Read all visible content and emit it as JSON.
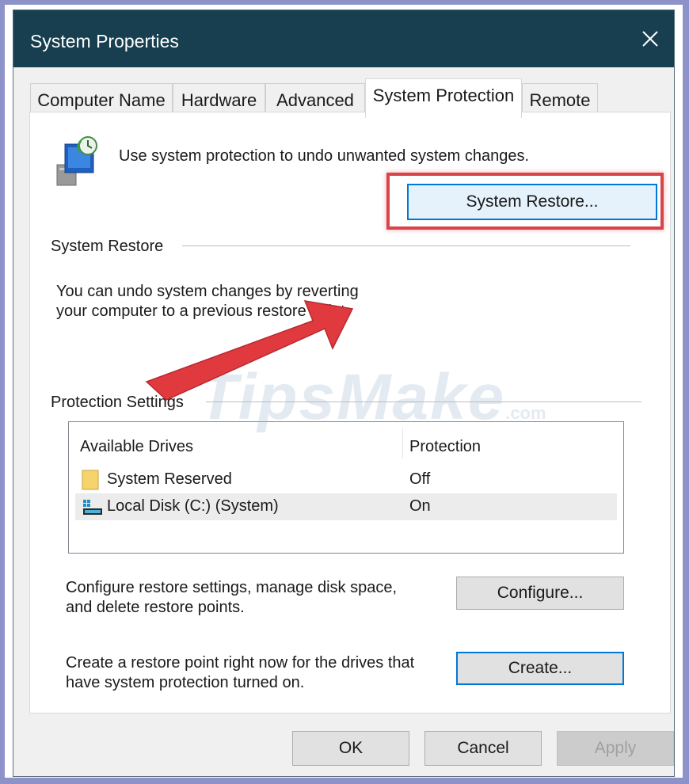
{
  "window": {
    "title": "System Properties"
  },
  "tabs": [
    {
      "label": "Computer Name"
    },
    {
      "label": "Hardware"
    },
    {
      "label": "Advanced"
    },
    {
      "label": "System Protection",
      "active": true
    },
    {
      "label": "Remote"
    }
  ],
  "header": {
    "description": "Use system protection to undo unwanted system changes."
  },
  "system_restore": {
    "group_label": "System Restore",
    "description_line1": "You can undo system changes by reverting",
    "description_line2": "your computer to a previous restore point.",
    "button_label": "System Restore..."
  },
  "protection_settings": {
    "group_label": "Protection Settings",
    "columns": [
      "Available Drives",
      "Protection"
    ],
    "drives": [
      {
        "name": "System Reserved",
        "protection": "Off",
        "icon": "folder-icon"
      },
      {
        "name": "Local Disk (C:) (System)",
        "protection": "On",
        "icon": "system-drive-icon",
        "selected": true
      }
    ]
  },
  "configure": {
    "text_line1": "Configure restore settings, manage disk space,",
    "text_line2": "and delete restore points.",
    "button_label": "Configure..."
  },
  "create": {
    "text_line1": "Create a restore point right now for the drives that",
    "text_line2": "have system protection turned on.",
    "button_label": "Create..."
  },
  "footer": {
    "ok_label": "OK",
    "cancel_label": "Cancel",
    "apply_label": "Apply"
  },
  "watermark": {
    "text": "TipsMake",
    "suffix": ".com"
  },
  "colors": {
    "titlebar": "#173f4f",
    "highlight": "#d9434a",
    "focus": "#0078d7",
    "outer_border": "#8d93c9"
  }
}
